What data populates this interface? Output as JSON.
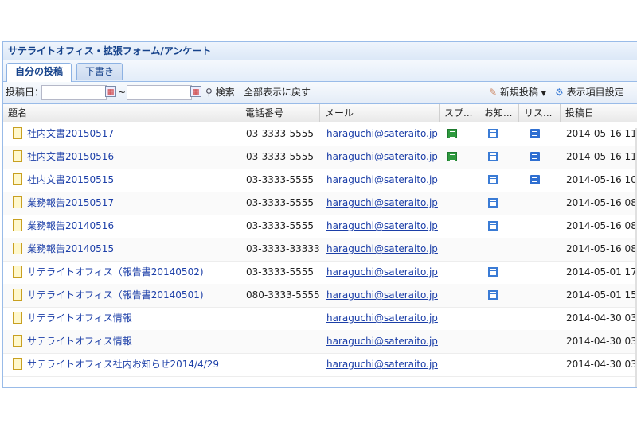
{
  "panel": {
    "title": "サテライトオフィス・拡張フォーム/アンケート"
  },
  "tabs": [
    {
      "label": "自分の投稿"
    },
    {
      "label": "下書き"
    }
  ],
  "toolbar": {
    "date_label": "投稿日：",
    "range_sep": "~",
    "search_label": "検索",
    "show_all_label": "全部表示に戻す",
    "new_post_label": "新規投稿",
    "display_settings_label": "表示項目設定"
  },
  "columns": [
    "題名",
    "電話番号",
    "メール",
    "スプ...",
    "お知...",
    "リス...",
    "投稿日"
  ],
  "rows": [
    {
      "title": "社内文書20150517",
      "phone": "03-3333-5555",
      "email": "haraguchi@sateraito.jp",
      "sheet": true,
      "form": true,
      "list": true,
      "date": "2014-05-16 11:"
    },
    {
      "title": "社内文書20150516",
      "phone": "03-3333-5555",
      "email": "haraguchi@sateraito.jp",
      "sheet": true,
      "form": true,
      "list": true,
      "date": "2014-05-16 11:"
    },
    {
      "title": "社内文書20150515",
      "phone": "03-3333-5555",
      "email": "haraguchi@sateraito.jp",
      "sheet": false,
      "form": true,
      "list": true,
      "date": "2014-05-16 10:"
    },
    {
      "title": "業務報告20150517",
      "phone": "03-3333-5555",
      "email": "haraguchi@sateraito.jp",
      "sheet": false,
      "form": true,
      "list": false,
      "date": "2014-05-16 08:"
    },
    {
      "title": "業務報告20140516",
      "phone": "03-3333-5555",
      "email": "haraguchi@sateraito.jp",
      "sheet": false,
      "form": true,
      "list": false,
      "date": "2014-05-16 08:"
    },
    {
      "title": "業務報告20140515",
      "phone": "03-3333-33333",
      "email": "haraguchi@sateraito.jp",
      "sheet": false,
      "form": false,
      "list": false,
      "date": "2014-05-16 08:"
    },
    {
      "title": "サテライトオフィス（報告書20140502)",
      "phone": "03-3333-5555",
      "email": "haraguchi@sateraito.jp",
      "sheet": false,
      "form": true,
      "list": false,
      "date": "2014-05-01 17:"
    },
    {
      "title": "サテライトオフィス（報告書20140501)",
      "phone": "080-3333-5555",
      "email": "haraguchi@sateraito.jp",
      "sheet": false,
      "form": true,
      "list": false,
      "date": "2014-05-01 15:"
    },
    {
      "title": "サテライトオフィス情報",
      "phone": "",
      "email": "haraguchi@sateraito.jp",
      "sheet": false,
      "form": false,
      "list": false,
      "date": "2014-04-30 03:"
    },
    {
      "title": "サテライトオフィス情報",
      "phone": "",
      "email": "haraguchi@sateraito.jp",
      "sheet": false,
      "form": false,
      "list": false,
      "date": "2014-04-30 03:"
    },
    {
      "title": "サテライトオフィス社内お知らせ2014/4/29",
      "phone": "",
      "email": "haraguchi@sateraito.jp",
      "sheet": false,
      "form": false,
      "list": false,
      "date": "2014-04-30 03:"
    }
  ]
}
